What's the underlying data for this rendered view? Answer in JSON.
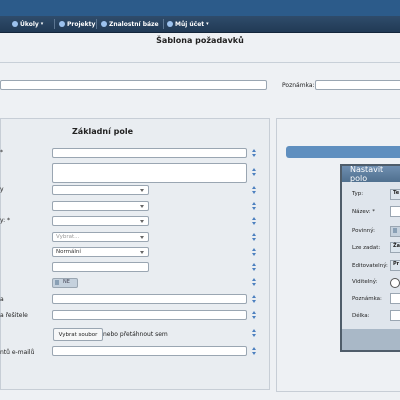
{
  "nav": {
    "items": [
      {
        "label": "Úkoly"
      },
      {
        "label": "Projekty"
      },
      {
        "label": "Znalostní báze"
      },
      {
        "label": "Můj účet"
      }
    ]
  },
  "page": {
    "title": "Šablona požadavků"
  },
  "header_form": {
    "note_label": "Poznámka:"
  },
  "basic": {
    "title": "Základní pole",
    "labels": {
      "l1": "*",
      "l2": "y",
      "l3": "y: *",
      "l4": "a",
      "l5": "a řešitele",
      "l6": "ntů e-mailů"
    },
    "select_placeholder": "Vybrat...",
    "priority_value": "Normální",
    "toggle_label": "NE",
    "file_button": "Vybrat soubor",
    "file_hint": "nebo přetáhnout sem"
  },
  "modal": {
    "title": "Nastavit polo",
    "labels": [
      "Typ:",
      "Název: *",
      "Povinný:",
      "Lze zadat:",
      "Editovatelný:",
      "Viditelný:",
      "Poznámka:",
      "Délka:"
    ],
    "typ_value": "Te",
    "lze_zadat_value": "Ža",
    "editovatelny_value": "Pr"
  }
}
